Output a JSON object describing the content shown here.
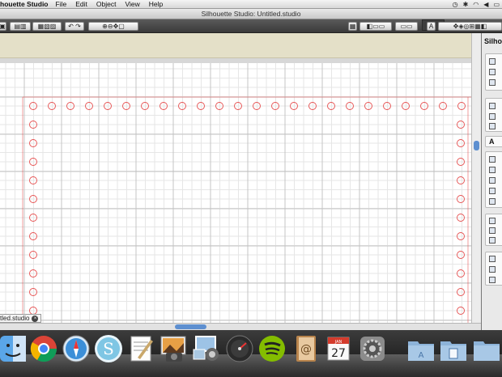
{
  "menubar": {
    "app": "houette Studio",
    "items": [
      "File",
      "Edit",
      "Object",
      "View",
      "Help"
    ]
  },
  "window": {
    "title": "Silhouette Studio: Untitled.studio"
  },
  "panel": {
    "title": "Silhou"
  },
  "doc_tab": {
    "name": "tled.studio"
  },
  "calendar": {
    "month": "JAN",
    "day": "27"
  },
  "colors": {
    "accent": "#5d8fd0",
    "cut_line": "#e65050",
    "canvas": "#ffffff",
    "tan_bar": "#e4e0c8"
  },
  "icons": [
    "open-icon",
    "save-icon",
    "print-icon",
    "undo-icon",
    "redo-icon",
    "zoom-in-icon",
    "zoom-out-icon",
    "pan-icon",
    "text-icon",
    "wifi-icon",
    "battery-icon"
  ]
}
